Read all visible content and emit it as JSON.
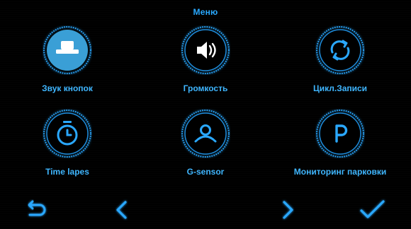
{
  "header": {
    "title": "Меню"
  },
  "menu": {
    "items": [
      {
        "label": "Звук кнопок",
        "icon": "button-sound-icon",
        "selected": true
      },
      {
        "label": "Громкость",
        "icon": "speaker-icon",
        "selected": false
      },
      {
        "label": "Цикл.Записи",
        "icon": "loop-record-icon",
        "selected": false
      },
      {
        "label": "Time lapes",
        "icon": "stopwatch-icon",
        "selected": false
      },
      {
        "label": "G-sensor",
        "icon": "person-icon",
        "selected": false
      },
      {
        "label": "Мониторинг парковки",
        "icon": "parking-icon",
        "selected": false
      }
    ]
  },
  "nav": {
    "back": {
      "icon": "return-arrow-icon"
    },
    "prev": {
      "icon": "chevron-left-icon"
    },
    "next": {
      "icon": "chevron-right-icon"
    },
    "confirm": {
      "icon": "checkmark-icon"
    }
  },
  "colors": {
    "accent": "#29a9ff",
    "accent_fill": "#3aa0d8",
    "background": "#000000"
  }
}
